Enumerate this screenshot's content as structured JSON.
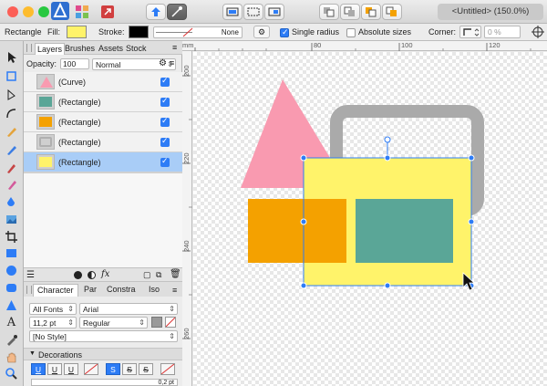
{
  "window": {
    "title": "<Untitled> (150.0%)"
  },
  "context_toolbar": {
    "tool_name": "Rectangle",
    "fill_label": "Fill:",
    "fill_color": "#fff36a",
    "stroke_label": "Stroke:",
    "stroke_color": "#000000",
    "stroke_width": "None",
    "single_radius_label": "Single radius",
    "single_radius_checked": true,
    "absolute_sizes_label": "Absolute sizes",
    "absolute_sizes_checked": false,
    "corner_label": "Corner:",
    "corner_value": "0 %"
  },
  "panel_tabs": [
    "Layers",
    "Brushes",
    "Assets",
    "Stock"
  ],
  "layers_panel": {
    "opacity_label": "Opacity:",
    "opacity_value": "100",
    "blend_mode": "Normal",
    "layers": [
      {
        "name": "(Curve)",
        "thumb_color": "#f99ab0",
        "visible": true,
        "selected": false
      },
      {
        "name": "(Rectangle)",
        "thumb_color": "#5aa697",
        "visible": true,
        "selected": false
      },
      {
        "name": "(Rectangle)",
        "thumb_color": "#f4a100",
        "visible": true,
        "selected": false
      },
      {
        "name": "(Rectangle)",
        "thumb_color": "#b0b0b0",
        "visible": true,
        "selected": false
      },
      {
        "name": "(Rectangle)",
        "thumb_color": "#fff36a",
        "visible": true,
        "selected": true
      }
    ]
  },
  "character_panel": {
    "tabs": [
      "Character",
      "Par",
      "Constra",
      "Iso"
    ],
    "font_collection": "All Fonts",
    "font_name": "Arial",
    "font_size": "11,2 pt",
    "font_style": "Regular",
    "text_style": "[No Style]",
    "decorations_label": "Decorations",
    "decoration_buttons": [
      "U",
      "U",
      "U",
      "",
      "S",
      "S",
      "S"
    ],
    "line_weight": "0,2 pt"
  },
  "rulers": {
    "unit": "mm",
    "horizontal_ticks": [
      "80",
      "100",
      "120"
    ],
    "vertical_ticks": [
      "200",
      "220",
      "240",
      "260"
    ]
  },
  "shape_colors": {
    "triangle": "#f99ab0",
    "gray_frame": "#aaaaaa",
    "yellow_rect": "#fff36a",
    "orange_rect": "#f4a100",
    "teal_rect": "#5aa697",
    "selection": "#2d7cf6"
  }
}
